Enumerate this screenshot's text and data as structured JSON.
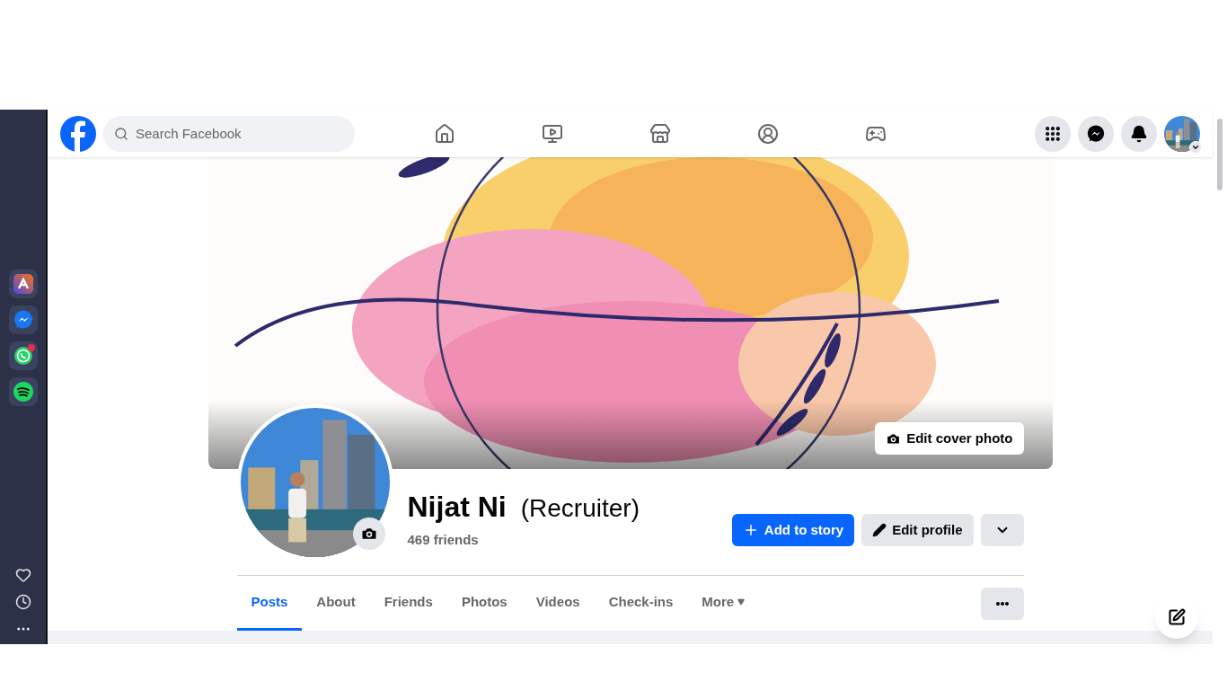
{
  "search": {
    "placeholder": "Search Facebook"
  },
  "cover": {
    "edit_button": "Edit cover photo"
  },
  "profile": {
    "name": "Nijat Ni",
    "role": "(Recruiter)",
    "friends": "469 friends"
  },
  "actions": [
    {
      "kind": "primary",
      "label": "Add to story"
    },
    {
      "kind": "secondary",
      "label": "Edit profile"
    },
    {
      "kind": "menu"
    }
  ],
  "tabs": [
    {
      "label": "Posts",
      "selected": true,
      "dropdown": false
    },
    {
      "label": "About",
      "selected": false,
      "dropdown": false
    },
    {
      "label": "Friends",
      "selected": false,
      "dropdown": false
    },
    {
      "label": "Photos",
      "selected": false,
      "dropdown": false
    },
    {
      "label": "Videos",
      "selected": false,
      "dropdown": false
    },
    {
      "label": "Check-ins",
      "selected": false,
      "dropdown": false
    },
    {
      "label": "More",
      "selected": false,
      "dropdown": true
    }
  ],
  "browser_apps": [
    {
      "kind": "arc",
      "notification": false
    },
    {
      "kind": "messenger",
      "notification": false
    },
    {
      "kind": "whatsapp",
      "notification": true
    },
    {
      "kind": "spotify",
      "notification": false
    }
  ]
}
